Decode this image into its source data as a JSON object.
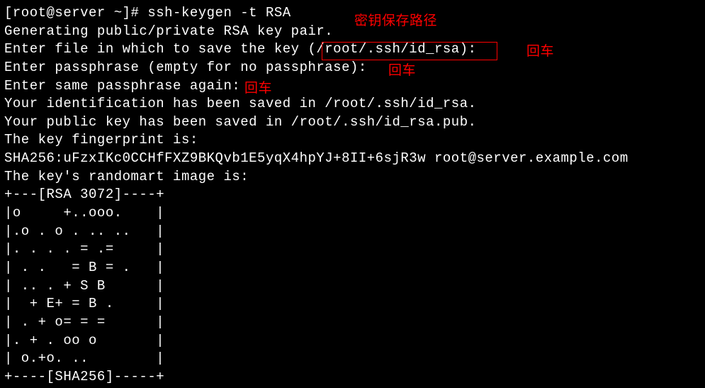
{
  "terminal": {
    "prompt": "[root@server ~]# ",
    "command": "ssh-keygen -t RSA",
    "lines": [
      "Generating public/private RSA key pair.",
      "Enter file in which to save the key (/root/.ssh/id_rsa): ",
      "Enter passphrase (empty for no passphrase): ",
      "Enter same passphrase again: ",
      "Your identification has been saved in /root/.ssh/id_rsa.",
      "Your public key has been saved in /root/.ssh/id_rsa.pub.",
      "The key fingerprint is:",
      "SHA256:uFzxIKc0CCHfFXZ9BKQvb1E5yqX4hpYJ+8II+6sjR3w root@server.example.com",
      "The key's randomart image is:",
      "+---[RSA 3072]----+",
      "|o     +..ooo.    |",
      "|.o . o . .. ..   |",
      "|. . . . = .=     |",
      "| . .   = B = .   |",
      "| .. . + S B      |",
      "|  + E+ = B .     |",
      "| . + o= = =      |",
      "|. + . oo o       |",
      "| o.+o. ..        |",
      "+----[SHA256]-----+"
    ]
  },
  "annotations": {
    "save_path_label": "密钥保存路径",
    "enter_key_1": "回车",
    "enter_key_2": "回车",
    "enter_key_3": "回车",
    "colors": {
      "red": "#ff0000"
    }
  }
}
